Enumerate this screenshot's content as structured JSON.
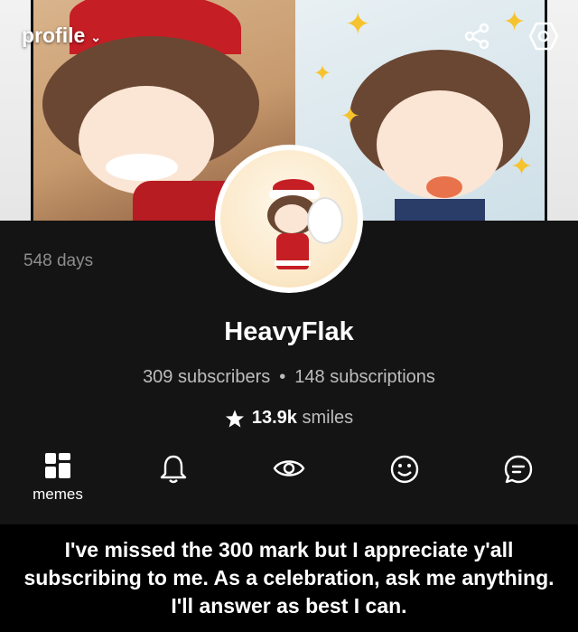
{
  "header": {
    "profile_label": "profile",
    "share_icon": "share-icon",
    "settings_icon": "hexagon-settings-icon"
  },
  "profile": {
    "days": "548 days",
    "username": "HeavyFlak",
    "subscribers": "309 subscribers",
    "separator": "•",
    "subscriptions": "148 subscriptions",
    "smiles_count": "13.9k",
    "smiles_label": "smiles"
  },
  "tabs": [
    {
      "icon": "grid-icon",
      "label": "memes",
      "active": true
    },
    {
      "icon": "bell-icon",
      "label": ""
    },
    {
      "icon": "eye-icon",
      "label": ""
    },
    {
      "icon": "smile-icon",
      "label": ""
    },
    {
      "icon": "comment-icon",
      "label": ""
    }
  ],
  "caption": "I've missed the 300 mark but I appreciate y'all subscribing to me. As a celebration, ask me anything. I'll answer as best I can.",
  "colors": {
    "background": "#141414",
    "caption_bg": "#000000",
    "muted_text": "#8d8d8d",
    "accent_star": "#f6c32e"
  }
}
